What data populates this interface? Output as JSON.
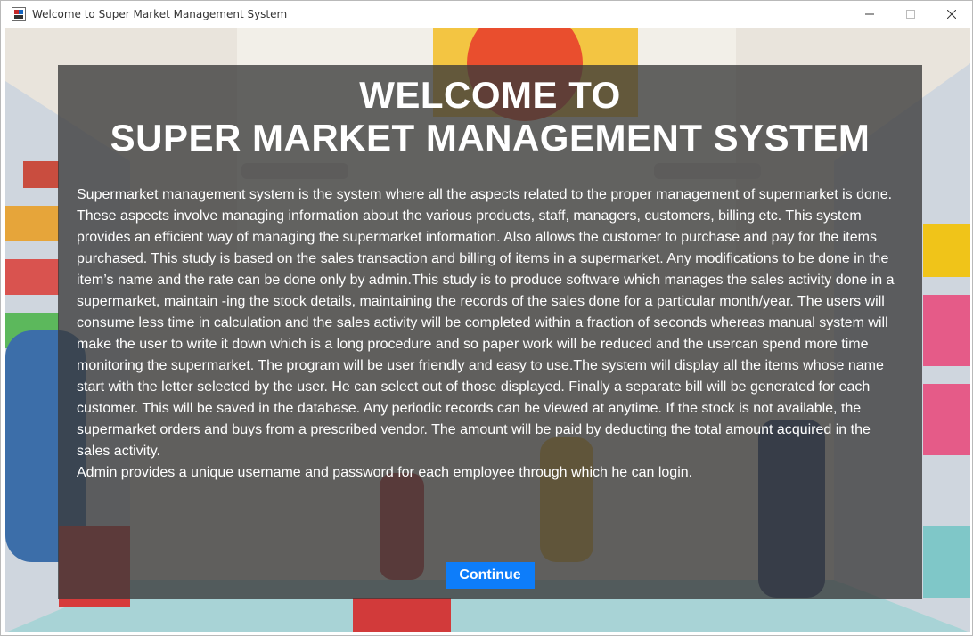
{
  "window": {
    "title": "Welcome to Super Market Management System",
    "controls": {
      "minimize": "minimize-icon",
      "maximize": "maximize-icon",
      "close": "close-icon"
    }
  },
  "welcome": {
    "heading_line1": "WELCOME TO",
    "heading_line2": "SUPER MARKET MANAGEMENT SYSTEM",
    "paragraph": "Supermarket management system is the system where all the aspects related to the proper management of supermarket is done. These aspects involve managing information about the various products, staff, managers, customers, billing etc. This system provides an efficient way of managing the supermarket information. Also allows the customer to purchase and pay for the items purchased. This study is based on the sales transaction and billing of items in a supermarket.  Any modifications to be done in the item’s name and the rate can be done only by admin.This study is to produce software which manages the sales activity done in a supermarket, maintain -ing the stock details, maintaining the records of the sales done for a particular month/year. The users will consume less time in calculation and the sales activity will be completed within a fraction of seconds whereas manual system will make the user to write it down which is a long procedure and so paper work will be reduced and the usercan spend more time monitoring the supermarket. The program will be user friendly and easy to use.The system will display all the items whose name start with the letter selected by the user. He can select out of those displayed. Finally a separate bill will be generated for each customer. This will be saved in the database. Any periodic records can be viewed at anytime. If the stock is not available, the supermarket orders and buys from a prescribed vendor. The amount will be paid by deducting the total amount acquired in the sales activity.",
    "admin_note": "Admin provides a unique username and password for each employee through which he can login.",
    "continue_label": "Continue"
  },
  "colors": {
    "overlay": "#3a3a3a",
    "button": "#0d7dfa",
    "text": "#ffffff"
  }
}
